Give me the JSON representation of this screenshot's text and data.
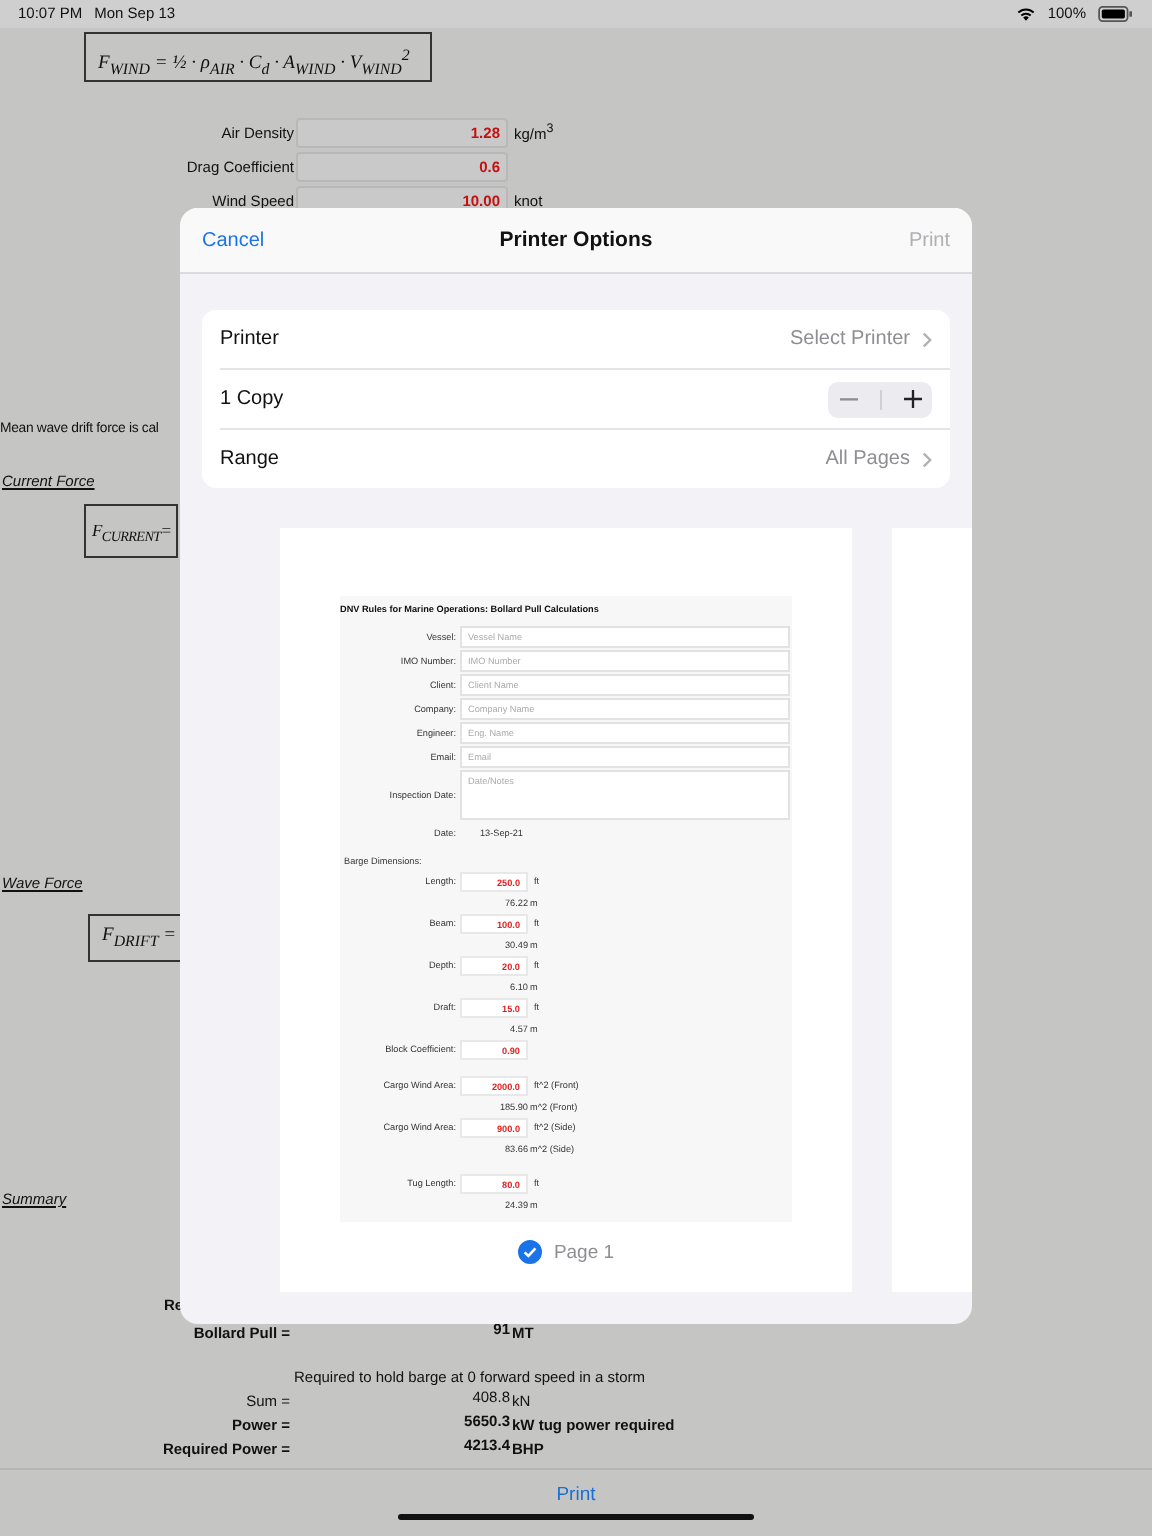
{
  "status_bar": {
    "time": "10:07 PM",
    "date": "Mon Sep 13",
    "battery": "100%"
  },
  "sheet": {
    "wind_formula": "F$_{WIND}$ = ½ · ρ$_{AIR}$ · C$_{d}$ · A$_{WIND}$ · V$_{WIND}$$^{2}$",
    "inputs": [
      {
        "label": "Air Density",
        "value": "1.28",
        "unit": "kg/m$^{3}$"
      },
      {
        "label": "Drag Coefficient",
        "value": "0.6"
      },
      {
        "label": "Wind Speed",
        "value": "10.00",
        "unit": "knot"
      }
    ],
    "note": "Mean wave drift force is cal",
    "current_heading": "Current Force",
    "current_formula": "F$_{CURRENT}$=",
    "wave_heading": "Wave Force",
    "wave_formula": "F$_{DRIFT}$ =",
    "summary_heading": "Summary",
    "cut_label": "Re",
    "results": [
      {
        "label": "Bollard Pull =",
        "value": "91",
        "unit": "MT",
        "bold": true
      },
      {
        "note": "Required to hold barge at 0 forward speed in a storm"
      },
      {
        "label": "Sum =",
        "value": "408.8",
        "unit": "kN",
        "bold": false
      },
      {
        "label": "Power =",
        "value": "5650.3",
        "unit": "kW tug power required",
        "bold": true
      },
      {
        "label": "Required Power =",
        "value": "4213.4",
        "unit": "BHP",
        "bold": true
      }
    ]
  },
  "dialog": {
    "cancel": "Cancel",
    "title": "Printer Options",
    "print": "Print",
    "printer": {
      "label": "Printer",
      "value": "Select Printer"
    },
    "copies": {
      "label": "1 Copy"
    },
    "range": {
      "label": "Range",
      "value": "All Pages"
    },
    "preview": {
      "title": "DNV Rules for Marine Operations: Bollard Pull Calculations",
      "fields": [
        {
          "label": "Vessel:",
          "placeholder": "Vessel Name"
        },
        {
          "label": "IMO Number:",
          "placeholder": "IMO Number"
        },
        {
          "label": "Client:",
          "placeholder": "Client Name"
        },
        {
          "label": "Company:",
          "placeholder": "Company Name"
        },
        {
          "label": "Engineer:",
          "placeholder": "Eng. Name"
        },
        {
          "label": "Email:",
          "placeholder": "Email"
        }
      ],
      "notes": {
        "label": "Inspection Date:",
        "placeholder": "Date/Notes"
      },
      "date": {
        "label": "Date:",
        "value": "13-Sep-21"
      },
      "section": "Barge Dimensions:",
      "groups": [
        [
          {
            "label": "Length:",
            "value": "250.0",
            "unit": "ft",
            "converted": "76.22",
            "converted_unit": "m"
          },
          {
            "label": "Beam:",
            "value": "100.0",
            "unit": "ft",
            "converted": "30.49",
            "converted_unit": "m"
          },
          {
            "label": "Depth:",
            "value": "20.0",
            "unit": "ft",
            "converted": "6.10",
            "converted_unit": "m"
          },
          {
            "label": "Draft:",
            "value": "15.0",
            "unit": "ft",
            "converted": "4.57",
            "converted_unit": "m"
          },
          {
            "label": "Block Coefficient:",
            "value": "0.90"
          }
        ],
        [
          {
            "label": "Cargo Wind Area:",
            "value": "2000.0",
            "unit": "ft^2 (Front)",
            "converted": "185.90",
            "converted_unit": "m^2 (Front)"
          },
          {
            "label": "Cargo Wind Area:",
            "value": "900.0",
            "unit": "ft^2 (Side)",
            "converted": "83.66",
            "converted_unit": "m^2 (Side)"
          }
        ],
        [
          {
            "label": "Tug Length:",
            "value": "80.0",
            "unit": "ft",
            "converted": "24.39",
            "converted_unit": "m"
          }
        ]
      ],
      "page": {
        "label": "Page 1",
        "selected": true
      }
    }
  },
  "toolbar": {
    "print": "Print"
  }
}
